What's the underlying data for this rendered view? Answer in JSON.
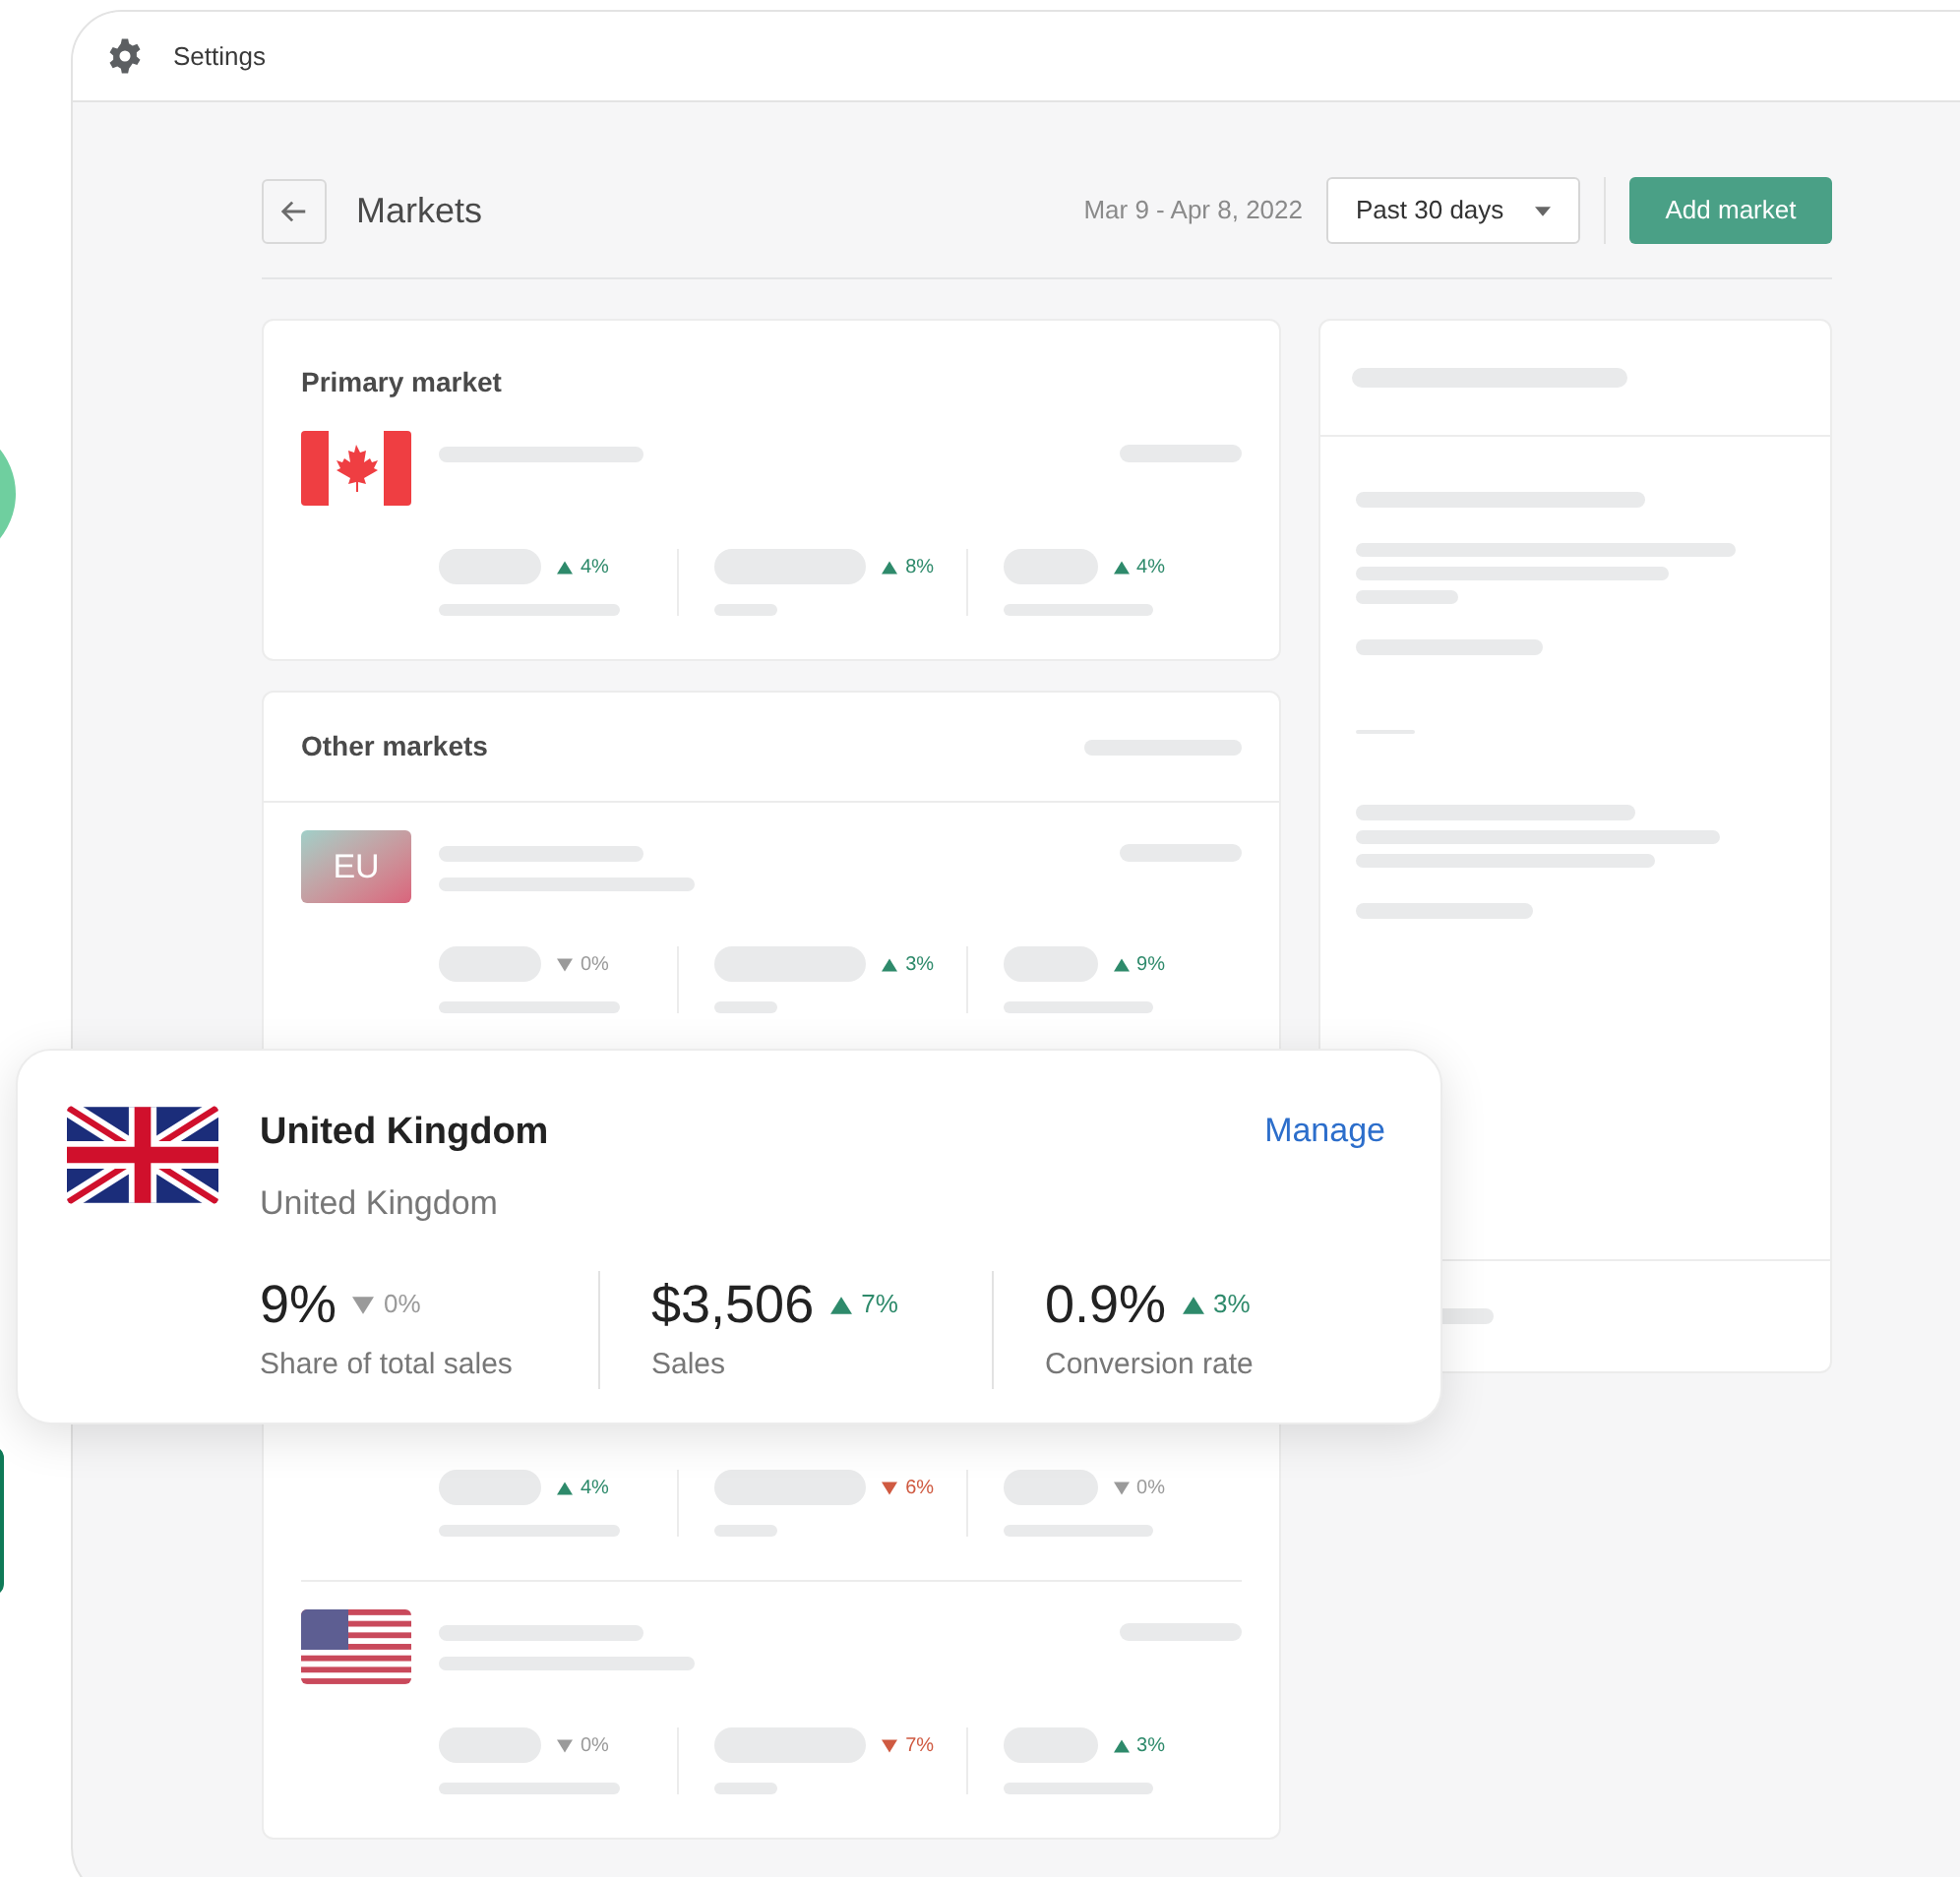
{
  "window": {
    "title": "Settings"
  },
  "header": {
    "title": "Markets",
    "date_range": "Mar 9 - Apr 8, 2022",
    "period_select": "Past 30 days",
    "add_button": "Add market"
  },
  "primary_market": {
    "title": "Primary market",
    "rows": [
      {
        "kind": "ca",
        "metrics": [
          {
            "kind": "up",
            "change": "4%"
          },
          {
            "kind": "up",
            "change": "8%"
          },
          {
            "kind": "up",
            "change": "4%"
          }
        ]
      }
    ]
  },
  "other_markets": {
    "title": "Other markets",
    "rows": [
      {
        "kind": "eu",
        "badge": "EU",
        "metrics": [
          {
            "kind": "flat",
            "change": "0%"
          },
          {
            "kind": "up",
            "change": "3%"
          },
          {
            "kind": "up",
            "change": "9%"
          }
        ]
      },
      {
        "kind": "covered",
        "metrics": [
          {
            "kind": "up",
            "change": "4%"
          },
          {
            "kind": "down",
            "change": "6%"
          },
          {
            "kind": "flat",
            "change": "0%"
          }
        ]
      },
      {
        "kind": "us",
        "metrics": [
          {
            "kind": "flat",
            "change": "0%"
          },
          {
            "kind": "down",
            "change": "7%"
          },
          {
            "kind": "up",
            "change": "3%"
          }
        ]
      }
    ]
  },
  "popup": {
    "name": "United Kingdom",
    "region": "United Kingdom",
    "action": "Manage",
    "metrics": [
      {
        "value": "9%",
        "kind": "flat",
        "change": "0%",
        "label": "Share of total sales"
      },
      {
        "value": "$3,506",
        "kind": "up",
        "change": "7%",
        "label": "Sales"
      },
      {
        "value": "0.9%",
        "kind": "up",
        "change": "3%",
        "label": "Conversion rate"
      }
    ]
  }
}
